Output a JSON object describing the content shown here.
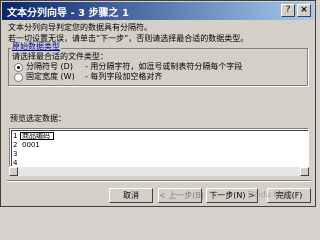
{
  "window": {
    "title": "文本分列向导 - 3 步骤之 1"
  },
  "titlebar": {
    "help": "?",
    "close": "×"
  },
  "description": {
    "line1": "文本分列向导判定您的数据具有分隔符。",
    "line2": "若一切设置无误，请单击“下一步”，否则请选择最合适的数据类型。"
  },
  "original_type": {
    "group_label": "原始数据类型",
    "prompt": "请选择最合适的文件类型：",
    "options": [
      {
        "label": "分隔符号 (D)",
        "desc": "- 用分隔字符，如逗号或制表符分隔每个字段",
        "selected": true
      },
      {
        "label": "固定宽度 (W)",
        "desc": "- 每列字段加空格对齐",
        "selected": false
      }
    ]
  },
  "preview": {
    "label": "预览选定数据：",
    "rows": [
      {
        "num": "1",
        "text": "商品编码"
      },
      {
        "num": "2",
        "text": "0001"
      },
      {
        "num": "3",
        "text": ""
      },
      {
        "num": "4",
        "text": ""
      }
    ]
  },
  "buttons": {
    "cancel": "取消",
    "back": "< 上一步(B)",
    "next": "下一步(N) >",
    "finish": "完成(F)"
  },
  "watermark": "Baidu 经验"
}
